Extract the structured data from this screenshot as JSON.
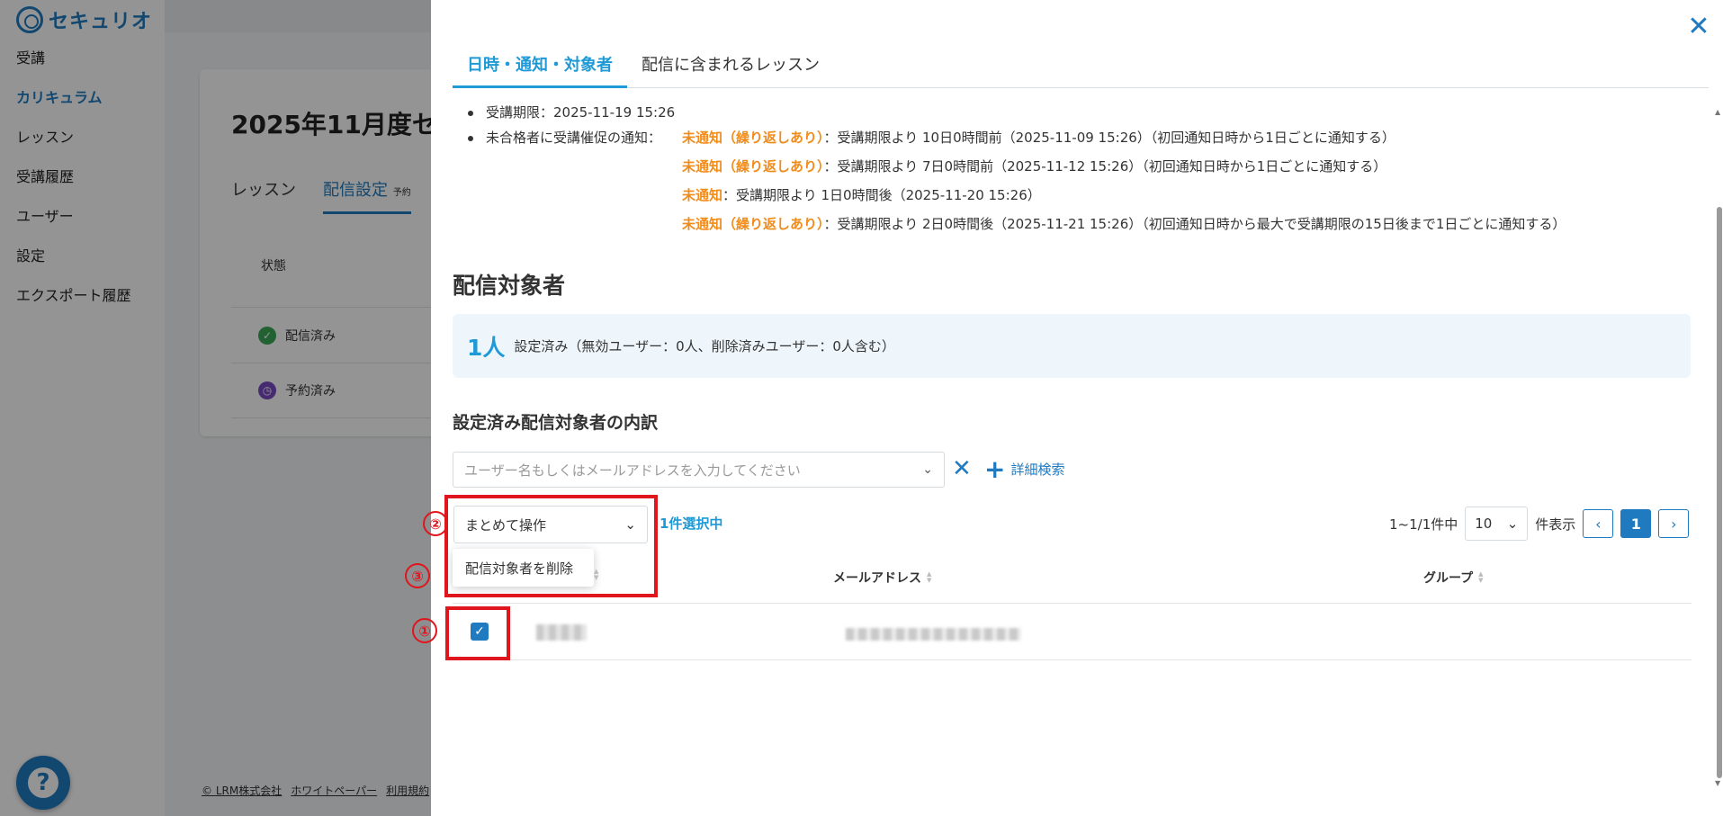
{
  "app": {
    "logo_text": "セキュリオ",
    "nav": [
      "受講",
      "カリキュラム",
      "レッスン",
      "受講履歴",
      "ユーザー",
      "設定",
      "エクスポート履歴"
    ],
    "active_nav": "カリキュラム"
  },
  "background_card": {
    "title": "2025年11月度セ",
    "tabs": [
      "レッスン",
      "配信設定"
    ],
    "tab_badge": "予約",
    "column_header": "状態",
    "rows": [
      "配信済み",
      "予約済み"
    ]
  },
  "footer": [
    "LRM株式会社",
    "ホワイトペーパー",
    "利用規約"
  ],
  "footer_prefix": "©",
  "drawer": {
    "tabs": [
      "日時・通知・対象者",
      "配信に含まれるレッスン"
    ],
    "deadline": "受講期限：2025-11-19 15:26",
    "reminder_label": "未合格者に受講催促の通知：",
    "reminders": [
      {
        "status": "未通知（繰り返しあり）",
        "text": "：受講期限より 10日0時間前（2025-11-09 15:26）（初回通知日時から1日ごとに通知する）"
      },
      {
        "status": "未通知（繰り返しあり）",
        "text": "：受講期限より 7日0時間前（2025-11-12 15:26）（初回通知日時から1日ごとに通知する）"
      },
      {
        "status": "未通知",
        "text": "：受講期限より 1日0時間後（2025-11-20 15:26）"
      },
      {
        "status": "未通知（繰り返しあり）",
        "text": "：受講期限より 2日0時間後（2025-11-21 15:26）（初回通知日時から最大で受講期限の15日後まで1日ごとに通知する）"
      }
    ],
    "targets_heading": "配信対象者",
    "count_number": "1人",
    "count_text": "設定済み（無効ユーザー：0人、削除済みユーザー：0人含む）",
    "breakdown_heading": "設定済み配信対象者の内訳",
    "search_placeholder": "ユーザー名もしくはメールアドレスを入力してください",
    "advanced_search": "詳細検索",
    "bulk_action_label": "まとめて操作",
    "selected_count": "1件選択中",
    "dropdown_item": "配信対象者を削除",
    "pager": {
      "range": "1~1/1件中",
      "per_page": "10",
      "per_page_suffix": "件表示",
      "current_page": "1"
    },
    "columns": [
      "メールアドレス",
      "グループ"
    ]
  },
  "annotations": [
    "①",
    "②",
    "③"
  ],
  "colors": {
    "accent": "#1f7ac0",
    "tab_active": "#1f9ad6",
    "warning": "#f08c1b",
    "annotation": "#e0161e"
  }
}
